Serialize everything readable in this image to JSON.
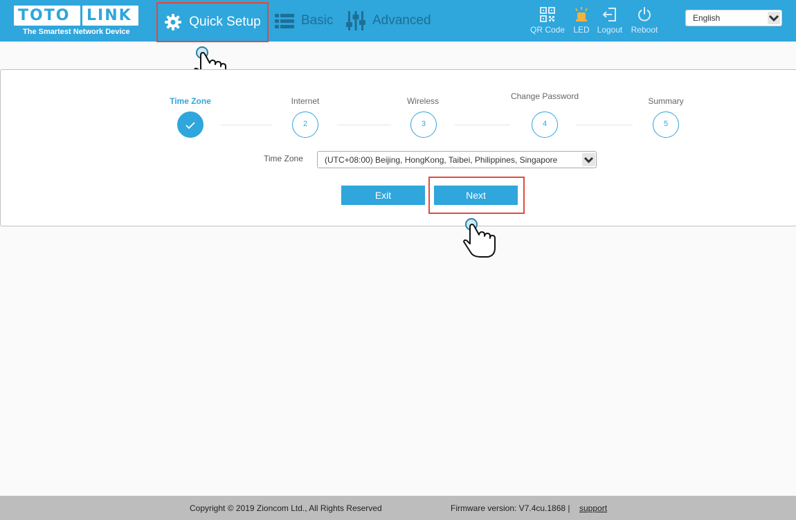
{
  "header": {
    "logo_left": "TOTO",
    "logo_right": "LINK",
    "tagline": "The Smartest Network Device",
    "nav": {
      "quick_setup": "Quick Setup",
      "basic": "Basic",
      "advanced": "Advanced"
    },
    "tools": {
      "qr": "QR Code",
      "led": "LED",
      "logout": "Logout",
      "reboot": "Reboot"
    },
    "language": "English"
  },
  "steps": [
    {
      "label": "Time Zone",
      "number": "",
      "state": "done"
    },
    {
      "label": "Internet",
      "number": "2",
      "state": "pending"
    },
    {
      "label": "Wireless",
      "number": "3",
      "state": "pending"
    },
    {
      "label": "Change Password",
      "number": "4",
      "state": "pending"
    },
    {
      "label": "Summary",
      "number": "5",
      "state": "pending"
    }
  ],
  "form": {
    "time_zone_label": "Time Zone",
    "time_zone_value": "(UTC+08:00) Beijing, HongKong, Taibei, Philippines, Singapore"
  },
  "buttons": {
    "exit": "Exit",
    "next": "Next"
  },
  "footer": {
    "copyright": "Copyright © 2019 Zioncom Ltd., All Rights Reserved",
    "firmware": "Firmware version: V7.4cu.1868  |",
    "support": "support"
  },
  "colors": {
    "accent": "#2fa6dc",
    "highlight": "#e14a3c",
    "footer": "#bdbdbd"
  },
  "icons": {
    "quick_setup": "gear-icon",
    "basic": "list-icon",
    "advanced": "sliders-icon",
    "qr": "qr-code-icon",
    "led": "led-icon",
    "logout": "logout-icon",
    "reboot": "power-icon"
  }
}
